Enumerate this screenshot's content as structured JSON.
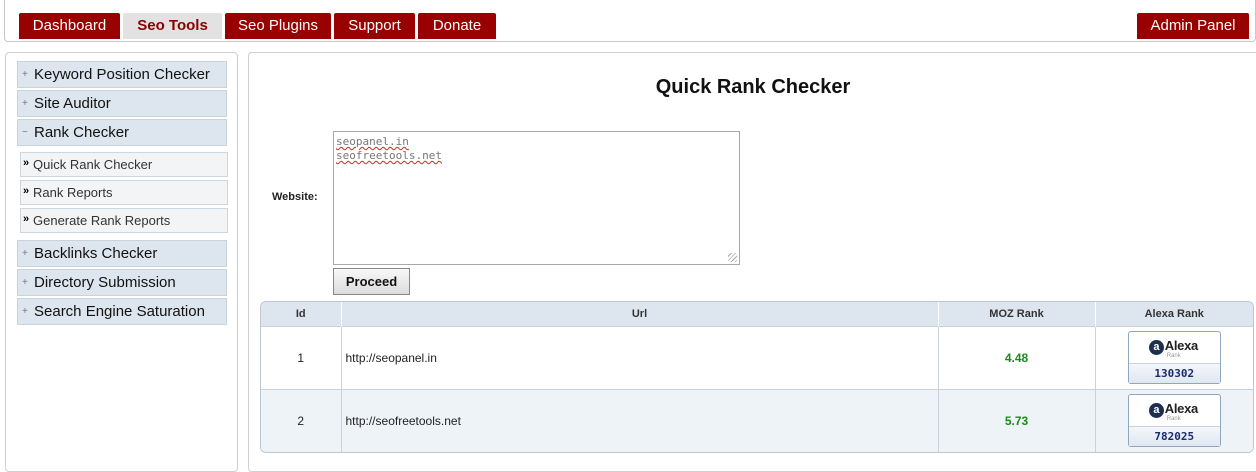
{
  "nav": {
    "tabs": [
      {
        "label": "Dashboard"
      },
      {
        "label": "Seo Tools"
      },
      {
        "label": "Seo Plugins"
      },
      {
        "label": "Support"
      },
      {
        "label": "Donate"
      }
    ],
    "active_tab": "Seo Tools",
    "admin_label": "Admin Panel"
  },
  "sidebar": {
    "items": [
      {
        "label": "Keyword Position Checker",
        "expander": "+"
      },
      {
        "label": "Site Auditor",
        "expander": "+"
      },
      {
        "label": "Rank Checker",
        "expander": "−"
      },
      {
        "label": "Backlinks Checker",
        "expander": "+"
      },
      {
        "label": "Directory Submission",
        "expander": "+"
      },
      {
        "label": "Search Engine Saturation",
        "expander": "+"
      }
    ],
    "subitems": [
      {
        "label": "Quick Rank Checker"
      },
      {
        "label": "Rank Reports"
      },
      {
        "label": "Generate Rank Reports"
      }
    ]
  },
  "main": {
    "title": "Quick Rank Checker",
    "website_label": "Website:",
    "websites": [
      "seopanel.in",
      "seofreetools.net"
    ],
    "proceed_label": "Proceed",
    "table": {
      "headers": [
        "Id",
        "Url",
        "MOZ Rank",
        "Alexa Rank"
      ],
      "rows": [
        {
          "id": "1",
          "url": "http://seopanel.in",
          "moz": "4.48",
          "alexa": "130302"
        },
        {
          "id": "2",
          "url": "http://seofreetools.net",
          "moz": "5.73",
          "alexa": "782025"
        }
      ]
    },
    "alexa_badge": {
      "brand": "Alexa",
      "icon_letter": "a",
      "sub": "Rank"
    }
  },
  "colors": {
    "nav_tab": "#990000",
    "active_tab_text": "#8b0000",
    "moz_rank": "#1a8a1a",
    "header_bg": "#dde6ee"
  }
}
